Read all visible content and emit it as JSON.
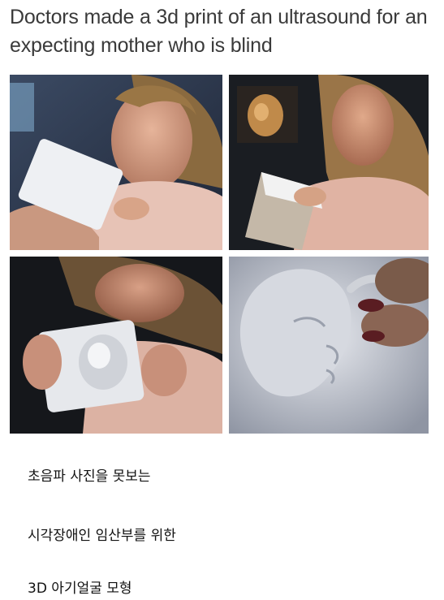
{
  "post": {
    "title": "Doctors made a 3d print of an ultrasound for an expecting mother who is blind"
  },
  "photos": [
    {
      "icon": "photo-woman-holding-print"
    },
    {
      "icon": "photo-woman-smiling-ultrasound-screen"
    },
    {
      "icon": "photo-woman-touching-baby-face-model"
    },
    {
      "icon": "photo-closeup-baby-face-model"
    }
  ],
  "caption": {
    "lines": [
      "초음파 사진을 못보는",
      "시각장애인 임산부를 위한",
      "3D 아기얼굴 모형"
    ]
  },
  "colors": {
    "text": "#3a3a3a",
    "background": "#ffffff"
  }
}
